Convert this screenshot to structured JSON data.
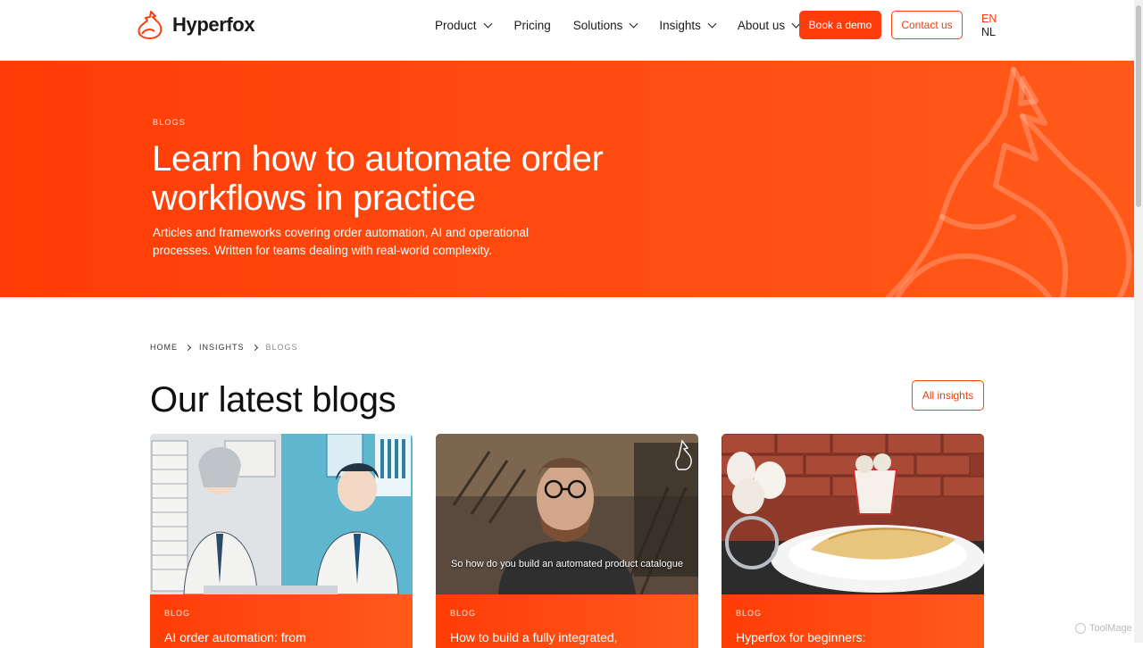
{
  "header": {
    "brand": "Hyperfox",
    "nav": [
      {
        "label": "Product",
        "dropdown": true
      },
      {
        "label": "Pricing",
        "dropdown": false
      },
      {
        "label": "Solutions",
        "dropdown": true
      },
      {
        "label": "Insights",
        "dropdown": true
      },
      {
        "label": "About us",
        "dropdown": true
      }
    ],
    "cta_demo": "Book a demo",
    "cta_contact": "Contact us",
    "lang_active": "EN",
    "lang_other": "NL"
  },
  "hero": {
    "eyebrow": "BLOGS",
    "title": "Learn how to automate order workflows in practice",
    "subtitle": "Articles and frameworks covering order automation, AI and operational processes. Written for teams dealing with real-world complexity."
  },
  "breadcrumb": {
    "items": [
      "HOME",
      "INSIGHTS",
      "BLOGS"
    ]
  },
  "section": {
    "title": "Our latest blogs",
    "all_button": "All insights"
  },
  "cards": [
    {
      "tag": "BLOG",
      "title": "AI order automation: from",
      "image": "illustration-overwhelmed-vs-efficient-office-workers",
      "caption": ""
    },
    {
      "tag": "BLOG",
      "title": "How to build a fully integrated,",
      "image": "video-still-bearded-man-with-glasses",
      "caption": "So how do you build an automated product catalogue"
    },
    {
      "tag": "BLOG",
      "title": "Hyperfox for beginners:",
      "image": "photo-crepes-on-plate-with-eggs",
      "caption": ""
    }
  ],
  "watermark": "ToolMage",
  "colors": {
    "accent": "#ff3c0c",
    "hero_gradient_start": "#ff3d06",
    "hero_gradient_end": "#ff5a1a",
    "text": "#111111"
  }
}
